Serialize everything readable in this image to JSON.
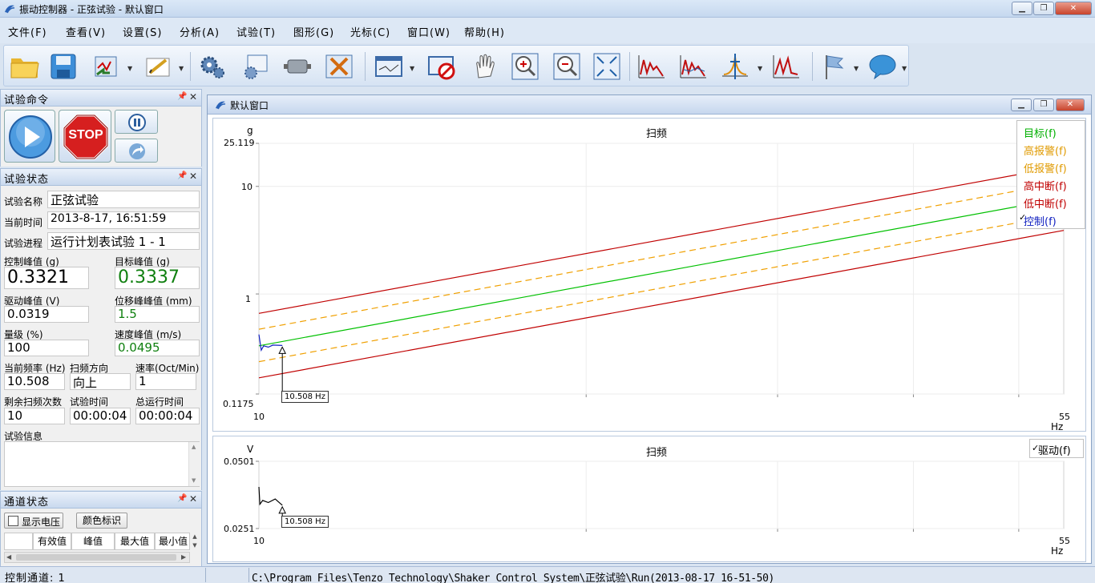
{
  "window": {
    "title": "振动控制器 - 正弦试验 - 默认窗口"
  },
  "menu": [
    "文件(F)",
    "查看(V)",
    "设置(S)",
    "分析(A)",
    "试验(T)",
    "图形(G)",
    "光标(C)",
    "窗口(W)",
    "帮助(H)"
  ],
  "toolbar": {
    "icons": [
      "open-folder-icon",
      "save-icon",
      "import-icon",
      "edit-icon",
      "settings-gears-icon",
      "config-icon",
      "shaker-icon",
      "tools-icon",
      "display-window-icon",
      "stop-display-icon",
      "pan-hand-icon",
      "zoom-in-icon",
      "zoom-out-icon",
      "fit-icon",
      "spectrum-icon",
      "spectrum-multi-icon",
      "cursor-peak-icon",
      "spectrum-overlay-icon",
      "flag-icon",
      "chat-icon"
    ]
  },
  "test_command": {
    "title": "试验命令",
    "stop_label": "STOP"
  },
  "test_status": {
    "title": "试验状态",
    "name_label": "试验名称",
    "name_value": "正弦试验",
    "time_label": "当前时间",
    "time_value": "2013-8-17, 16:51:59",
    "progress_label": "试验进程",
    "progress_value": "运行计划表试验 1 - 1",
    "control_peak_label": "控制峰值 (g)",
    "control_peak_value": "0.3321",
    "target_peak_label": "目标峰值 (g)",
    "target_peak_value": "0.3337",
    "drive_peak_label": "驱动峰值 (V)",
    "drive_peak_value": "0.0319",
    "disp_peak_label": "位移峰峰值 (mm)",
    "disp_peak_value": "1.5",
    "level_label": "量级 (%)",
    "level_value": "100",
    "vel_peak_label": "速度峰值 (m/s)",
    "vel_peak_value": "0.0495",
    "freq_label": "当前频率 (Hz)",
    "freq_value": "10.508",
    "dir_label": "扫频方向",
    "dir_value": "向上",
    "rate_label": "速率(Oct/Min)",
    "rate_value": "1",
    "remain_label": "剩余扫频次数",
    "remain_value": "10",
    "test_time_label": "试验时间",
    "test_time_value": "00:00:04",
    "total_time_label": "总运行时间",
    "total_time_value": "00:00:04",
    "info_label": "试验信息"
  },
  "channel_status": {
    "title": "通道状态",
    "show_voltage_label": "显示电压",
    "color_label_button": "颜色标识",
    "columns": [
      "有效值",
      "峰值",
      "最大值",
      "最小值"
    ]
  },
  "inner_window": {
    "title": "默认窗口"
  },
  "chart_data": [
    {
      "type": "line",
      "title": "扫频",
      "ylabel": "g",
      "xlabel": "Hz",
      "log_x": true,
      "log_y": true,
      "xlim": [
        10,
        55
      ],
      "ylim": [
        0.1175,
        25.119
      ],
      "y_tick_labels": [
        "25.119",
        "10",
        "1",
        "0.1175"
      ],
      "x_tick_labels": [
        "10",
        "55"
      ],
      "cursor_label": "10.508 Hz",
      "cursor_x": 10.508,
      "legend_position": "top-right",
      "series": [
        {
          "name": "目标(f)",
          "color": "#00c000",
          "dash": false,
          "x": [
            10,
            55
          ],
          "y": [
            0.33,
            7.8
          ]
        },
        {
          "name": "高报警(f)",
          "color": "#f0a000",
          "dash": true,
          "x": [
            10,
            55
          ],
          "y": [
            0.47,
            10.9
          ]
        },
        {
          "name": "低报警(f)",
          "color": "#f0a000",
          "dash": true,
          "x": [
            10,
            55
          ],
          "y": [
            0.235,
            5.5
          ]
        },
        {
          "name": "高中断(f)",
          "color": "#c00000",
          "dash": false,
          "x": [
            10,
            55
          ],
          "y": [
            0.66,
            15.4
          ]
        },
        {
          "name": "低中断(f)",
          "color": "#c00000",
          "dash": false,
          "x": [
            10,
            55
          ],
          "y": [
            0.166,
            3.9
          ]
        },
        {
          "name": "控制(f)",
          "color": "#1020c0",
          "dash": false,
          "checked": true,
          "x": [
            10,
            10.05,
            10.1,
            10.2,
            10.3,
            10.508
          ],
          "y": [
            0.42,
            0.3,
            0.33,
            0.32,
            0.335,
            0.3321
          ]
        }
      ]
    },
    {
      "type": "line",
      "title": "扫频",
      "ylabel": "V",
      "xlabel": "Hz",
      "log_x": true,
      "log_y": true,
      "xlim": [
        10,
        55
      ],
      "ylim": [
        0.0251,
        0.0501
      ],
      "y_tick_labels": [
        "0.0501",
        "0.0251"
      ],
      "x_tick_labels": [
        "10",
        "55"
      ],
      "cursor_label": "10.508 Hz",
      "cursor_x": 10.508,
      "legend_position": "top-right",
      "series": [
        {
          "name": "驱动(f)",
          "color": "#000000",
          "dash": false,
          "checked": true,
          "x": [
            10,
            10.02,
            10.08,
            10.2,
            10.35,
            10.508
          ],
          "y": [
            0.0385,
            0.0322,
            0.0335,
            0.0328,
            0.034,
            0.0319
          ]
        }
      ]
    }
  ],
  "statusbar": {
    "channel": "控制通道: 1",
    "path": "C:\\Program Files\\Tenzo Technology\\Shaker Control System\\正弦试验\\Run(2013-08-17 16-51-50)"
  }
}
